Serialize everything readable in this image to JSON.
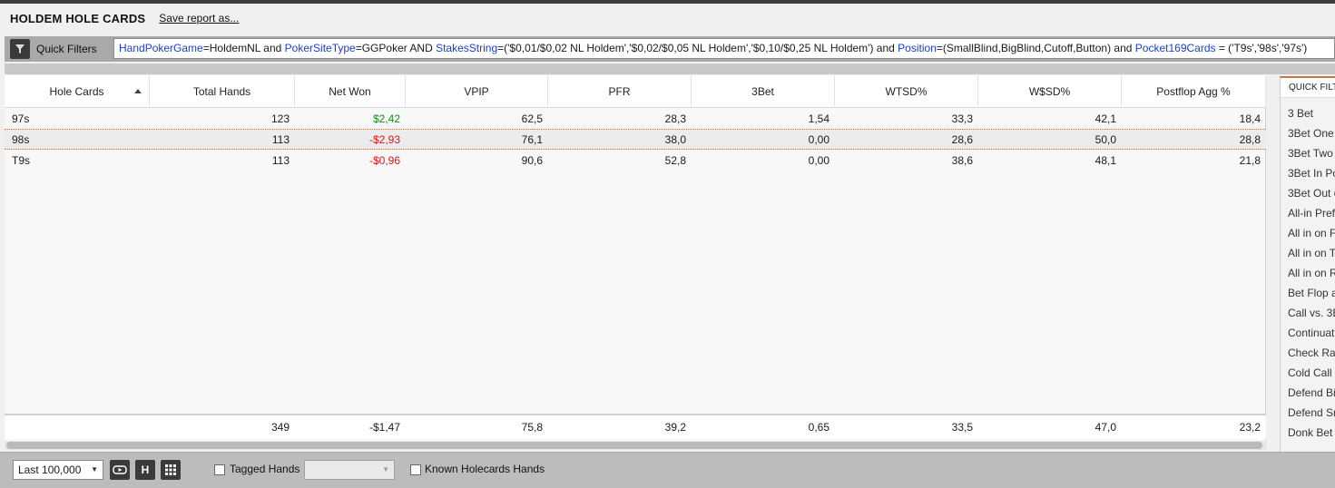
{
  "report": {
    "title": "HOLDEM HOLE CARDS",
    "save_label": "Save report as..."
  },
  "filter": {
    "label": "Quick Filters",
    "tokens": [
      {
        "t": "HandPokerGame",
        "kw": true
      },
      {
        "t": "=HoldemNL and ",
        "kw": false
      },
      {
        "t": "PokerSiteType",
        "kw": true
      },
      {
        "t": "=GGPoker AND ",
        "kw": false
      },
      {
        "t": "StakesString",
        "kw": true
      },
      {
        "t": "=('$0,01/$0,02 NL Holdem','$0,02/$0,05 NL Holdem','$0,10/$0,25 NL Holdem') and ",
        "kw": false
      },
      {
        "t": "Position",
        "kw": true
      },
      {
        "t": "=(SmallBlind,BigBlind,Cutoff,Button) and ",
        "kw": false
      },
      {
        "t": "Pocket169Cards",
        "kw": true
      },
      {
        "t": " = ('T9s','98s','97s')",
        "kw": false
      }
    ]
  },
  "table": {
    "columns": [
      "Hole Cards",
      "Total Hands",
      "Net Won",
      "VPIP",
      "PFR",
      "3Bet",
      "WTSD%",
      "W$SD%",
      "Postflop Agg %"
    ],
    "rows": [
      {
        "cards": "97s",
        "hands": "123",
        "net": "$2,42",
        "net_sign": "pos",
        "vpip": "62,5",
        "pfr": "28,3",
        "threebet": "1,54",
        "wtsd": "33,3",
        "wsd": "42,1",
        "agg": "18,4"
      },
      {
        "cards": "98s",
        "hands": "113",
        "net": "-$2,93",
        "net_sign": "neg",
        "vpip": "76,1",
        "pfr": "38,0",
        "threebet": "0,00",
        "wtsd": "28,6",
        "wsd": "50,0",
        "agg": "28,8"
      },
      {
        "cards": "T9s",
        "hands": "113",
        "net": "-$0,96",
        "net_sign": "neg",
        "vpip": "90,6",
        "pfr": "52,8",
        "threebet": "0,00",
        "wtsd": "38,6",
        "wsd": "48,1",
        "agg": "21,8"
      }
    ],
    "totals": {
      "hands": "349",
      "net": "-$1,47",
      "vpip": "75,8",
      "pfr": "39,2",
      "threebet": "0,65",
      "wtsd": "33,5",
      "wsd": "47,0",
      "agg": "23,2"
    }
  },
  "quick_filters_panel": {
    "title": "QUICK FILT",
    "items": [
      "3 Bet",
      "3Bet One",
      "3Bet Two I",
      "3Bet In Po",
      "3Bet Out o",
      "All-in Pref",
      "All in on F",
      "All in on T",
      "All in on R",
      "Bet Flop a",
      "Call vs. 3B",
      "Continuat",
      "Check Rai",
      "Cold Call",
      "Defend Bi",
      "Defend Sr",
      "Donk Bet"
    ]
  },
  "bottom": {
    "range_value": "Last 100,000",
    "h_label": "H",
    "tagged_label": "Tagged Hands",
    "known_label": "Known Holecards Hands"
  },
  "colors": {
    "positive": "#1a8a1a",
    "negative": "#e01414",
    "keyword": "#1a3fd0",
    "accent": "#c2764a"
  }
}
